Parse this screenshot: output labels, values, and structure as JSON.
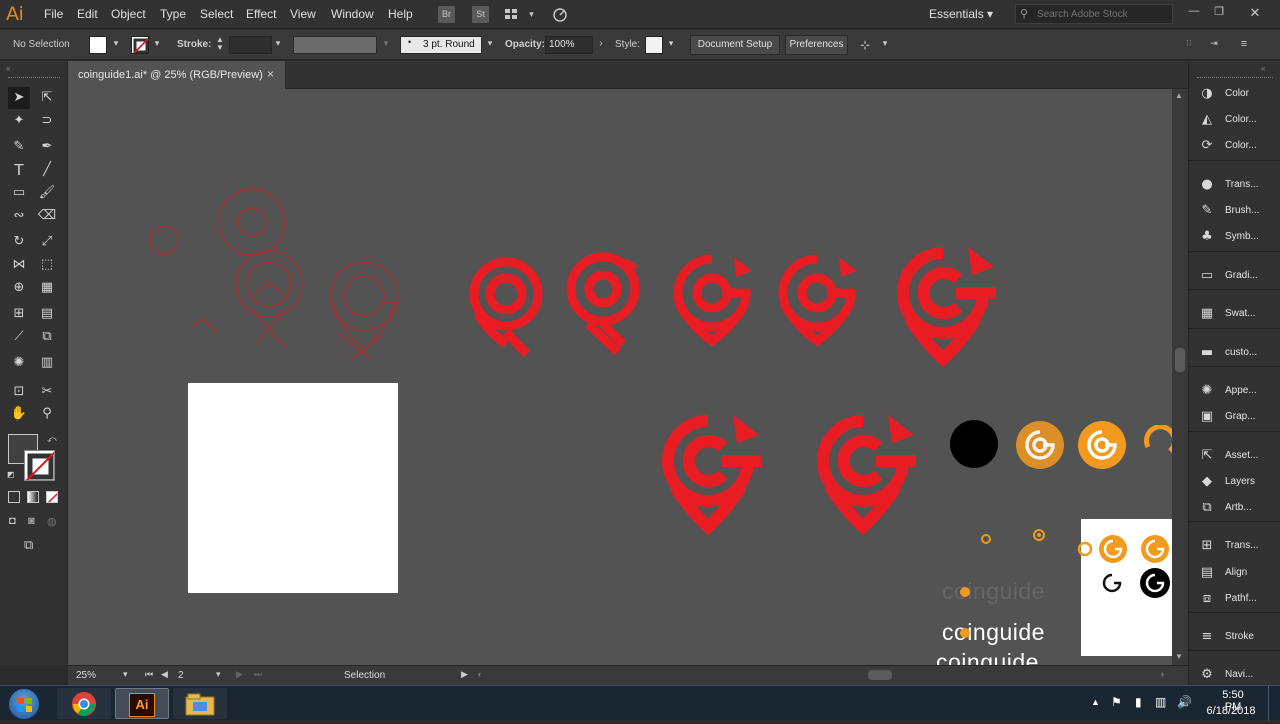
{
  "app": {
    "logo": "Ai"
  },
  "menu": [
    "File",
    "Edit",
    "Object",
    "Type",
    "Select",
    "Effect",
    "View",
    "Window",
    "Help"
  ],
  "app_buttons": [
    "Br",
    "St"
  ],
  "workspace": {
    "label": "Essentials"
  },
  "search": {
    "placeholder": "Search Adobe Stock"
  },
  "control": {
    "selection": "No Selection",
    "stroke_label": "Stroke:",
    "brush": "3 pt. Round",
    "opacity_label": "Opacity:",
    "opacity_value": "100%",
    "style_label": "Style:",
    "doc_setup": "Document Setup",
    "preferences": "Preferences"
  },
  "tab": {
    "title": "coinguide1.ai* @ 25% (RGB/Preview)",
    "close": "×"
  },
  "canvas": {
    "brand_text": "coinguide",
    "accent_red": "#ea1c23",
    "accent_orange": "#f39a1e"
  },
  "status": {
    "zoom": "25%",
    "artboard": "2",
    "mode": "Selection"
  },
  "panels": [
    {
      "icon": "color-icon",
      "label": "Color"
    },
    {
      "icon": "color-guide-icon",
      "label": "Color..."
    },
    {
      "icon": "color-themes-icon",
      "label": "Color..."
    },
    {
      "icon": "transparency-icon",
      "label": "Trans..."
    },
    {
      "icon": "brushes-icon",
      "label": "Brush..."
    },
    {
      "icon": "symbols-icon",
      "label": "Symb..."
    },
    {
      "icon": "gradient-icon",
      "label": "Gradi..."
    },
    {
      "icon": "swatches-icon",
      "label": "Swat..."
    },
    {
      "icon": "custom-icon",
      "label": "custo..."
    },
    {
      "icon": "appearance-icon",
      "label": "Appe..."
    },
    {
      "icon": "graphic-styles-icon",
      "label": "Grap..."
    },
    {
      "icon": "asset-export-icon",
      "label": "Asset..."
    },
    {
      "icon": "layers-icon",
      "label": "Layers"
    },
    {
      "icon": "artboards-icon",
      "label": "Artb..."
    },
    {
      "icon": "transform-icon",
      "label": "Trans..."
    },
    {
      "icon": "align-icon",
      "label": "Align"
    },
    {
      "icon": "pathfinder-icon",
      "label": "Pathf..."
    },
    {
      "icon": "stroke-icon",
      "label": "Stroke"
    },
    {
      "icon": "navigator-icon",
      "label": "Navi..."
    }
  ],
  "taskbar": {
    "time": "5:50 PM",
    "date": "6/18/2018",
    "ai_label": "Ai"
  }
}
